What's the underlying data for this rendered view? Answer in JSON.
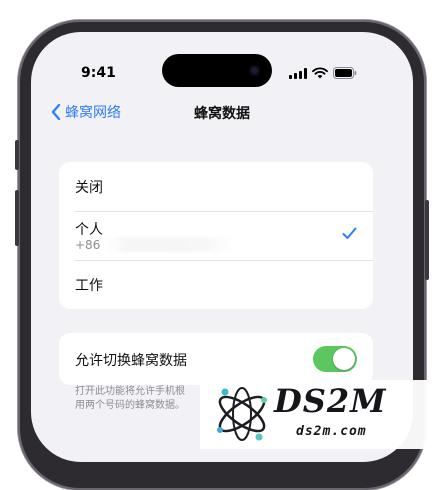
{
  "status_bar": {
    "time": "9:41"
  },
  "nav": {
    "back_label": "蜂窝网络",
    "title": "蜂窝数据"
  },
  "data_options": {
    "items": [
      {
        "label": "关闭",
        "selected": false
      },
      {
        "label": "个人",
        "number_prefix": "+86",
        "selected": true
      },
      {
        "label": "工作",
        "selected": false
      }
    ]
  },
  "switching": {
    "label": "允许切换蜂窝数据",
    "enabled": true,
    "footer_line1": "打开此功能将允许手机根",
    "footer_line2": "用两个号码的蜂窝数据。"
  },
  "watermark": {
    "brand": "DS2M",
    "domain": "ds2m.com"
  },
  "colors": {
    "accent": "#2f7df6",
    "toggle_on": "#5bc75e",
    "background": "#f2f1f6"
  }
}
